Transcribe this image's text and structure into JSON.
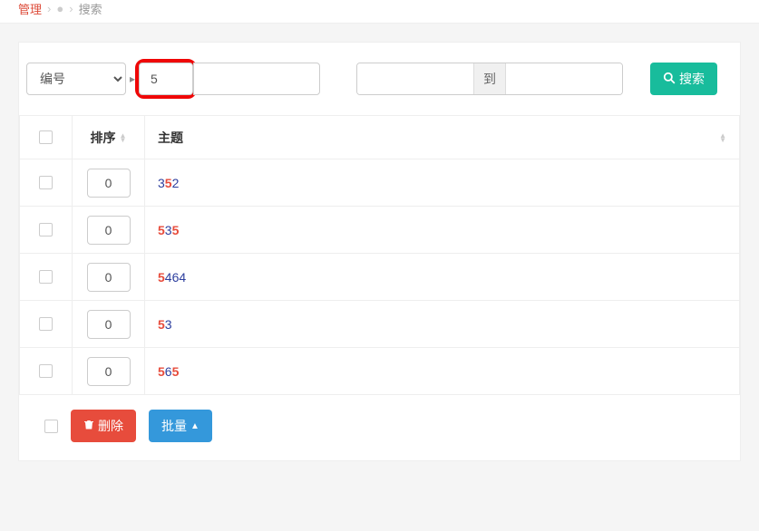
{
  "breadcrumb": {
    "title_fragment": "管理",
    "sep": "›",
    "search": "搜索"
  },
  "filter": {
    "dropdown": "编号",
    "search_value": "5",
    "range_mid": "到",
    "search_btn": "搜索"
  },
  "table": {
    "headers": {
      "sort": "排序",
      "topic": "主题"
    },
    "rows": [
      {
        "sort": "0",
        "topic_parts": [
          {
            "t": "3",
            "hl": false
          },
          {
            "t": "5",
            "hl": true
          },
          {
            "t": "2",
            "hl": false
          }
        ]
      },
      {
        "sort": "0",
        "topic_parts": [
          {
            "t": "5",
            "hl": true
          },
          {
            "t": "3",
            "hl": false
          },
          {
            "t": "5",
            "hl": true
          }
        ]
      },
      {
        "sort": "0",
        "topic_parts": [
          {
            "t": "5",
            "hl": true
          },
          {
            "t": "464",
            "hl": false
          }
        ]
      },
      {
        "sort": "0",
        "topic_parts": [
          {
            "t": "5",
            "hl": true
          },
          {
            "t": "3",
            "hl": false
          }
        ]
      },
      {
        "sort": "0",
        "topic_parts": [
          {
            "t": "5",
            "hl": true
          },
          {
            "t": "6",
            "hl": false
          },
          {
            "t": "5",
            "hl": true
          }
        ]
      }
    ]
  },
  "footer": {
    "delete": "删除",
    "batch": "批量"
  }
}
